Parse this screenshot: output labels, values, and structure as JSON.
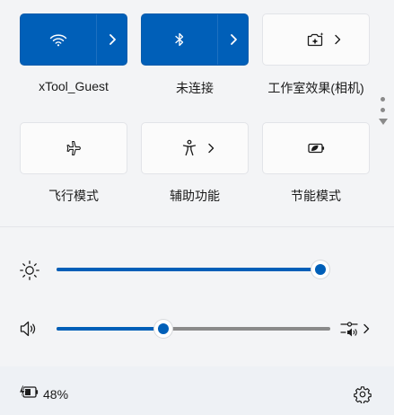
{
  "quick_settings": {
    "wifi": {
      "label": "xTool_Guest",
      "state": "on",
      "icon": "wifi-icon"
    },
    "bluetooth": {
      "label": "未连接",
      "state": "on",
      "icon": "bluetooth-icon"
    },
    "studio_effects": {
      "label": "工作室效果(相机)",
      "state": "off",
      "icon": "camera-sparkle-icon"
    },
    "airplane_mode": {
      "label": "飞行模式",
      "state": "off",
      "icon": "airplane-icon"
    },
    "accessibility": {
      "label": "辅助功能",
      "state": "off",
      "icon": "accessibility-icon"
    },
    "energy_saver": {
      "label": "节能模式",
      "state": "off",
      "icon": "leaf-battery-icon"
    }
  },
  "sliders": {
    "brightness": {
      "icon": "sun-icon",
      "value_fraction": 0.99
    },
    "volume": {
      "icon": "speaker-icon",
      "value_fraction": 0.39,
      "output_icon": "audio-output-icon"
    }
  },
  "footer": {
    "battery_icon": "battery-charging-icon",
    "battery_text": "48%",
    "settings_icon": "gear-icon"
  },
  "colors": {
    "accent": "#005fb8",
    "tile_off": "#fbfbfb",
    "panel_bg": "#f3f4f6",
    "track_unfilled": "#8a8a8a"
  }
}
